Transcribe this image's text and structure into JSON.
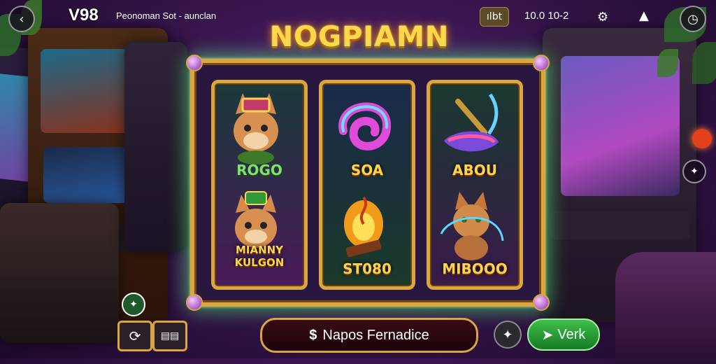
{
  "top_bar": {
    "brand": "V98",
    "subtitle": "Peonoman Sot - aunclan",
    "badge": "ılbt",
    "stats": "10.0  10-2"
  },
  "game": {
    "title": "NOGPIAMN"
  },
  "reels": [
    {
      "top_label": "ROGO",
      "bottom_label": "MIANNY KULGON"
    },
    {
      "top_label": "SOA",
      "bottom_label": "ST080"
    },
    {
      "top_label": "ABOU",
      "bottom_label": "MIBOOO"
    }
  ],
  "controls": {
    "main_button_label": "Napos Fernadice",
    "main_button_icon": "$",
    "action_button_label": "Verk"
  },
  "colors": {
    "gold": "#d9a640",
    "green_glow": "#50ff78",
    "title_yellow": "#ffd84a",
    "verk_green": "#2fa83a"
  }
}
